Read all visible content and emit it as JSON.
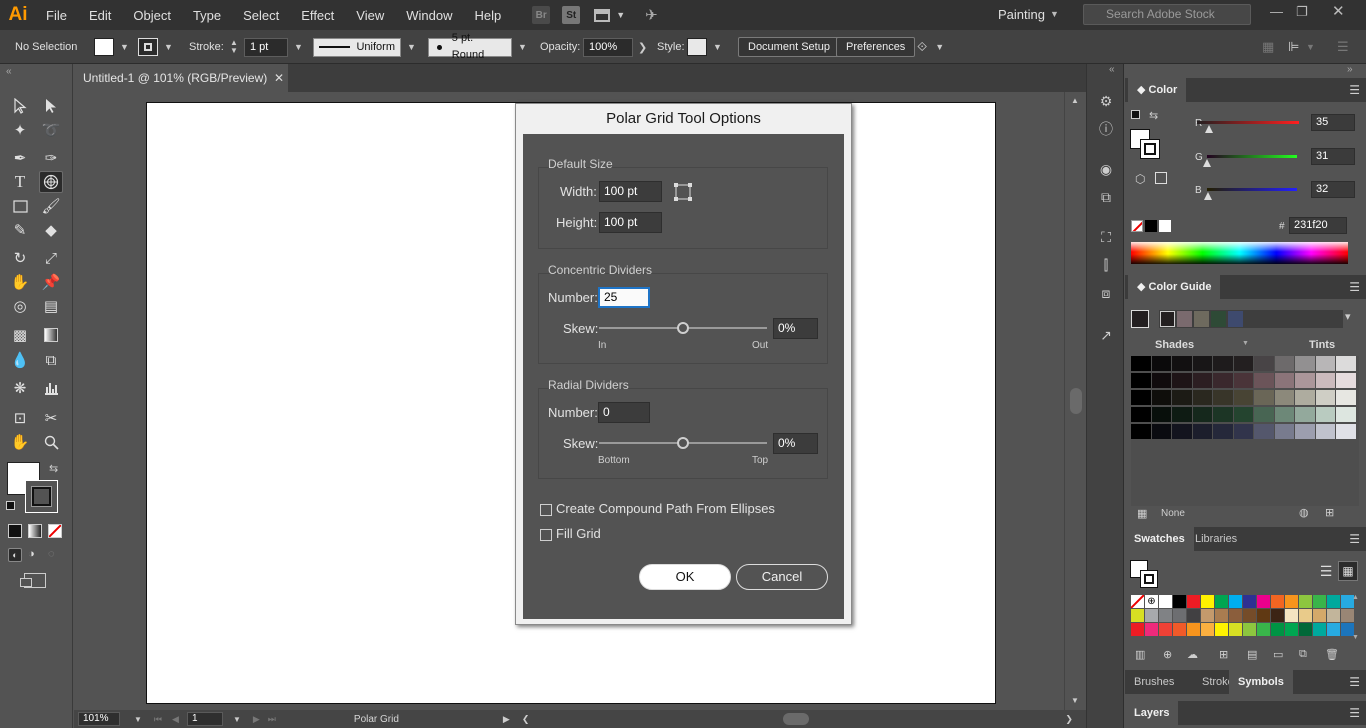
{
  "menubar": {
    "logo": "Ai",
    "items": [
      "File",
      "Edit",
      "Object",
      "Type",
      "Select",
      "Effect",
      "View",
      "Window",
      "Help"
    ],
    "bridge": "Br",
    "stock": "St",
    "workspace": "Painting",
    "search_placeholder": "Search Adobe Stock"
  },
  "controlbar": {
    "selection": "No Selection",
    "stroke_label": "Stroke:",
    "stroke_weight": "1 pt",
    "profile": "Uniform",
    "brush": "5 pt. Round",
    "opacity_label": "Opacity:",
    "opacity": "100%",
    "style_label": "Style:",
    "doc_setup": "Document Setup",
    "preferences": "Preferences"
  },
  "document": {
    "tab": "Untitled-1 @ 101% (RGB/Preview)",
    "zoom": "101%",
    "artboard_num": "1",
    "status_tool": "Polar Grid"
  },
  "dialog": {
    "title": "Polar Grid Tool Options",
    "default_size": {
      "title": "Default Size",
      "width_label": "Width:",
      "width": "100 pt",
      "height_label": "Height:",
      "height": "100 pt"
    },
    "concentric": {
      "title": "Concentric Dividers",
      "number_label": "Number:",
      "number": "25",
      "skew_label": "Skew:",
      "skew": "0%",
      "skew_value": 0,
      "left": "In",
      "right": "Out"
    },
    "radial": {
      "title": "Radial Dividers",
      "number_label": "Number:",
      "number": "0",
      "skew_label": "Skew:",
      "skew": "0%",
      "skew_value": 0,
      "left": "Bottom",
      "right": "Top"
    },
    "compound_path": "Create Compound Path From Ellipses",
    "compound_checked": false,
    "fill_grid": "Fill Grid",
    "fill_checked": false,
    "ok": "OK",
    "cancel": "Cancel"
  },
  "color_panel": {
    "tab": "Color",
    "r_label": "R",
    "r": "35",
    "g_label": "G",
    "g": "31",
    "b_label": "B",
    "b": "32",
    "hex_label": "#",
    "hex": "231f20"
  },
  "color_guide": {
    "tab": "Color Guide",
    "shades": "Shades",
    "tints": "Tints",
    "none": "None",
    "harmony": [
      "#7a6a6e",
      "#6e6a5e",
      "#2e4a36",
      "#3e4a6e"
    ],
    "grid_rows": [
      [
        "#000000",
        "#0b0a0b",
        "#121011",
        "#181617",
        "#1e1b1c",
        "#231f20",
        "#484446",
        "#6d6a6b",
        "#929091",
        "#b8b6b7",
        "#dcdbdb"
      ],
      [
        "#000000",
        "#100b0d",
        "#1e1417",
        "#2c1e22",
        "#3a282d",
        "#4a3439",
        "#6b5459",
        "#8b7479",
        "#ab969a",
        "#cbbabd",
        "#e6dcde"
      ],
      [
        "#000000",
        "#0f0e0b",
        "#1c1b15",
        "#2a281f",
        "#383529",
        "#484434",
        "#6a6657",
        "#8c897b",
        "#aeac9f",
        "#cfcec5",
        "#e7e7e2"
      ],
      [
        "#000000",
        "#080f0b",
        "#0e1b13",
        "#15281c",
        "#1c3525",
        "#24442f",
        "#486553",
        "#6d8878",
        "#93a99c",
        "#b9cbc0",
        "#dde6e0"
      ],
      [
        "#000000",
        "#0a0b10",
        "#13141e",
        "#1c1e2c",
        "#25283a",
        "#31344b",
        "#54576c",
        "#787b8e",
        "#9c9eae",
        "#c0c2cd",
        "#e0e1e7"
      ]
    ]
  },
  "swatches": {
    "tab": "Swatches",
    "libraries_tab": "Libraries",
    "rows": [
      [
        "none",
        "reg",
        "#ffffff",
        "#000000",
        "#ed1c24",
        "#fff200",
        "#00a651",
        "#00aeef",
        "#2e3192",
        "#ec008c",
        "#f26522",
        "#f7941d",
        "#8dc63f",
        "#39b54a",
        "#00a99d",
        "#27aae1",
        "#1c75bc",
        "#92278f",
        "#be1e2d",
        "#f15a29",
        "#fbb040"
      ],
      [
        "#d7df23",
        "#a7a9ac",
        "#808285",
        "#6d6e71",
        "#414042",
        "#c49a6c",
        "#a97c50",
        "#8b5e3c",
        "#754c29",
        "#603913",
        "#3c2415",
        "#f4e4c1",
        "#e9cb8a",
        "#d4a96a",
        "#c2b59b",
        "#998675",
        "#736357",
        "#534741",
        "#ffffff",
        "#e0e0e0",
        "#bcbec0"
      ],
      [
        "#ed1c24",
        "#ee2a7b",
        "#ef4136",
        "#f15a29",
        "#f7941d",
        "#fbb040",
        "#fff200",
        "#d7df23",
        "#8dc63f",
        "#39b54a",
        "#009444",
        "#00a651",
        "#006838",
        "#00a99d",
        "#27aae1",
        "#1c75bc",
        "#2b3990",
        "#262262",
        "#662d91",
        "#92278f",
        "#9e1f63"
      ]
    ]
  },
  "bottom_tabs": {
    "brushes": "Brushes",
    "stroke": "Stroke",
    "symbols": "Symbols",
    "layers": "Layers"
  }
}
